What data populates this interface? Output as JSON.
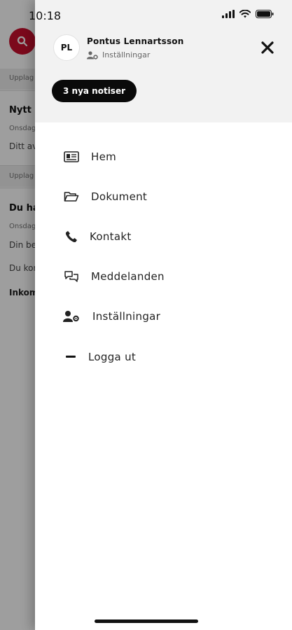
{
  "status_bar": {
    "time": "10:18"
  },
  "background": {
    "rows": [
      {
        "label": "Upplag"
      },
      {
        "title": "Nytt",
        "day": "Onsdag",
        "body": "Ditt av"
      },
      {
        "label": "Upplag"
      },
      {
        "title": "Du ha",
        "day": "Onsdag",
        "body": "Din be",
        "extra": "Du kon",
        "extra2": "Inkom"
      }
    ]
  },
  "drawer": {
    "user": {
      "initials": "PL",
      "name": "Pontus Lennartsson",
      "settings_link": "Inställningar"
    },
    "notifications_label": "3 nya notiser",
    "menu": [
      {
        "label": "Hem",
        "icon": "home-card-icon"
      },
      {
        "label": "Dokument",
        "icon": "folder-open-icon"
      },
      {
        "label": "Kontakt",
        "icon": "phone-icon"
      },
      {
        "label": "Meddelanden",
        "icon": "chat-bubbles-icon"
      },
      {
        "label": "Inställningar",
        "icon": "user-settings-icon"
      },
      {
        "label": "Logga ut",
        "icon": "minus-icon"
      }
    ]
  },
  "colors": {
    "brand_red": "#c8102e",
    "pill_black": "#0a0a0a",
    "header_gray": "#f2f2f2"
  }
}
